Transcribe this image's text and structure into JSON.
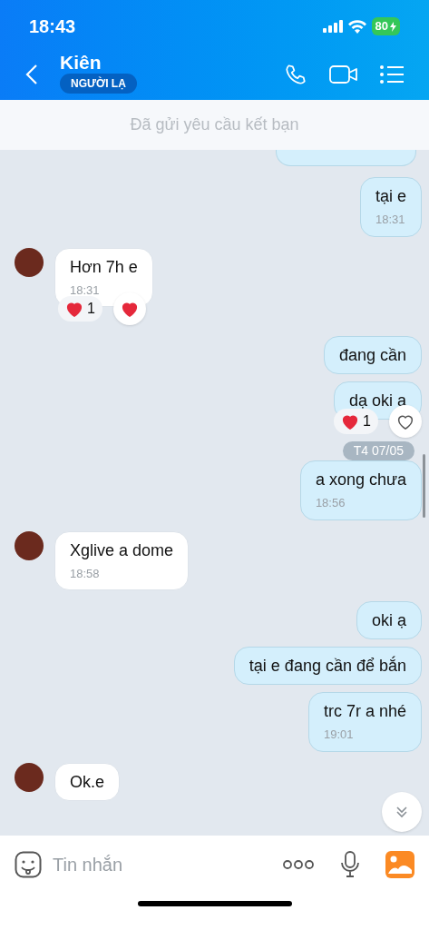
{
  "status_bar": {
    "time": "18:43",
    "battery": "80"
  },
  "header": {
    "name": "Kiên",
    "badge": "NGƯỜI LẠ"
  },
  "banner": "Đã gửi yêu cầu kết bạn",
  "messages": [
    {
      "kind": "outgoing",
      "text": "tại e",
      "time": "18:31"
    },
    {
      "kind": "incoming",
      "text": "Hơn 7h e",
      "time": "18:31",
      "reaction": {
        "count": "1",
        "liked": true
      }
    },
    {
      "kind": "outgoing",
      "text": "đang cần"
    },
    {
      "kind": "outgoing",
      "text": "dạ oki a",
      "reaction": {
        "count": "1",
        "liked": false
      }
    },
    {
      "kind": "date",
      "text": "T4 07/05"
    },
    {
      "kind": "outgoing",
      "text": "a xong chưa",
      "time": "18:56"
    },
    {
      "kind": "incoming",
      "text": "Xglive a dome",
      "time": "18:58"
    },
    {
      "kind": "outgoing",
      "text": "oki ạ"
    },
    {
      "kind": "outgoing",
      "text": "tại e đang cần để bắn"
    },
    {
      "kind": "outgoing",
      "text": "trc 7r a nhé",
      "time": "19:01"
    },
    {
      "kind": "incoming",
      "text": "Ok.e"
    }
  ],
  "composer": {
    "placeholder": "Tin nhắn"
  }
}
